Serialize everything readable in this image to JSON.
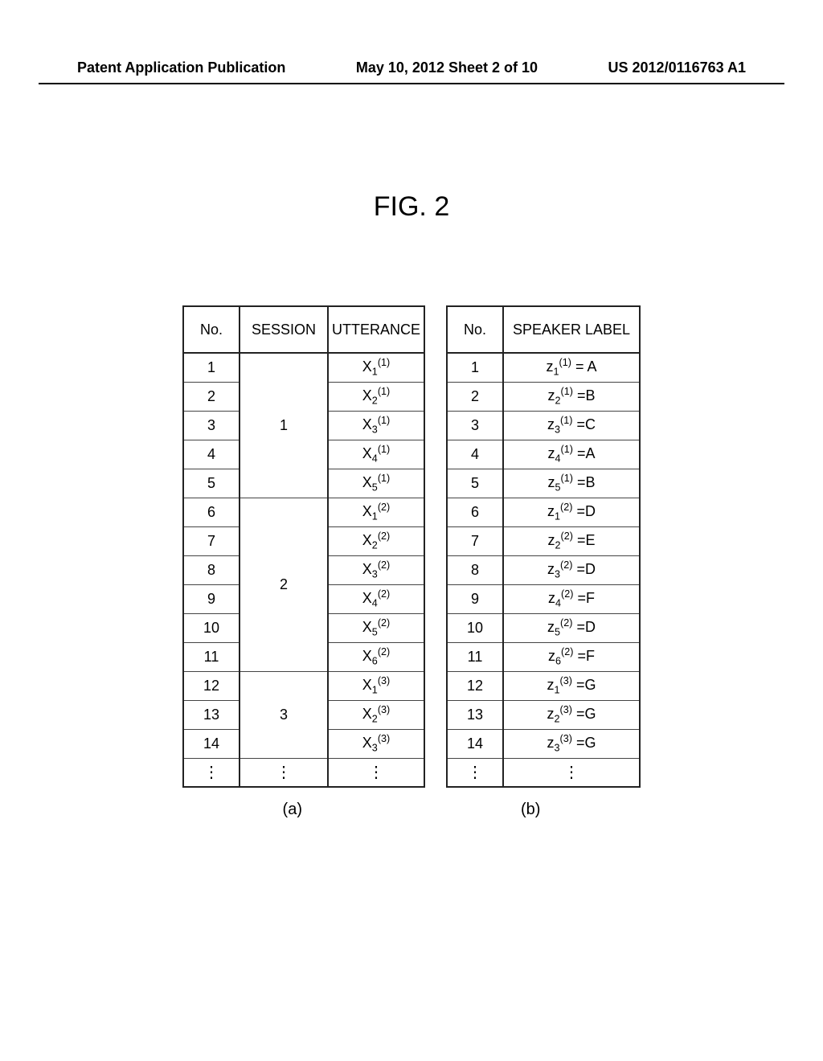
{
  "header": {
    "left": "Patent Application Publication",
    "center": "May 10, 2012  Sheet 2 of 10",
    "right": "US 2012/0116763 A1"
  },
  "figure_label": "FIG. 2",
  "tableA": {
    "col0": "No.",
    "col1": "SESSION",
    "col2": "UTTERANCE",
    "sessions": [
      {
        "session": "1",
        "rows": [
          {
            "no": "1",
            "utter_base": "X",
            "sub": "1",
            "sup": "(1)"
          },
          {
            "no": "2",
            "utter_base": "X",
            "sub": "2",
            "sup": "(1)"
          },
          {
            "no": "3",
            "utter_base": "X",
            "sub": "3",
            "sup": "(1)"
          },
          {
            "no": "4",
            "utter_base": "X",
            "sub": "4",
            "sup": "(1)"
          },
          {
            "no": "5",
            "utter_base": "X",
            "sub": "5",
            "sup": "(1)"
          }
        ]
      },
      {
        "session": "2",
        "rows": [
          {
            "no": "6",
            "utter_base": "X",
            "sub": "1",
            "sup": "(2)"
          },
          {
            "no": "7",
            "utter_base": "X",
            "sub": "2",
            "sup": "(2)"
          },
          {
            "no": "8",
            "utter_base": "X",
            "sub": "3",
            "sup": "(2)"
          },
          {
            "no": "9",
            "utter_base": "X",
            "sub": "4",
            "sup": "(2)"
          },
          {
            "no": "10",
            "utter_base": "X",
            "sub": "5",
            "sup": "(2)"
          },
          {
            "no": "11",
            "utter_base": "X",
            "sub": "6",
            "sup": "(2)"
          }
        ]
      },
      {
        "session": "3",
        "rows": [
          {
            "no": "12",
            "utter_base": "X",
            "sub": "1",
            "sup": "(3)"
          },
          {
            "no": "13",
            "utter_base": "X",
            "sub": "2",
            "sup": "(3)"
          },
          {
            "no": "14",
            "utter_base": "X",
            "sub": "3",
            "sup": "(3)"
          }
        ]
      }
    ],
    "ellipsis": "⋮"
  },
  "tableB": {
    "col0": "No.",
    "col1": "SPEAKER LABEL",
    "rows": [
      {
        "no": "1",
        "base": "z",
        "sub": "1",
        "sup": "(1)",
        "eq": " = A"
      },
      {
        "no": "2",
        "base": "z",
        "sub": "2",
        "sup": "(1)",
        "eq": " =B"
      },
      {
        "no": "3",
        "base": "z",
        "sub": "3",
        "sup": "(1)",
        "eq": " =C"
      },
      {
        "no": "4",
        "base": "z",
        "sub": "4",
        "sup": "(1)",
        "eq": " =A"
      },
      {
        "no": "5",
        "base": "z",
        "sub": "5",
        "sup": "(1)",
        "eq": " =B"
      },
      {
        "no": "6",
        "base": "z",
        "sub": "1",
        "sup": "(2)",
        "eq": " =D"
      },
      {
        "no": "7",
        "base": "z",
        "sub": "2",
        "sup": "(2)",
        "eq": " =E"
      },
      {
        "no": "8",
        "base": "z",
        "sub": "3",
        "sup": "(2)",
        "eq": " =D"
      },
      {
        "no": "9",
        "base": "z",
        "sub": "4",
        "sup": "(2)",
        "eq": " =F"
      },
      {
        "no": "10",
        "base": "z",
        "sub": "5",
        "sup": "(2)",
        "eq": " =D"
      },
      {
        "no": "11",
        "base": "z",
        "sub": "6",
        "sup": "(2)",
        "eq": " =F"
      },
      {
        "no": "12",
        "base": "z",
        "sub": "1",
        "sup": "(3)",
        "eq": " =G"
      },
      {
        "no": "13",
        "base": "z",
        "sub": "2",
        "sup": "(3)",
        "eq": " =G"
      },
      {
        "no": "14",
        "base": "z",
        "sub": "3",
        "sup": "(3)",
        "eq": " =G"
      }
    ],
    "ellipsis": "⋮"
  },
  "captions": {
    "a": "(a)",
    "b": "(b)"
  }
}
